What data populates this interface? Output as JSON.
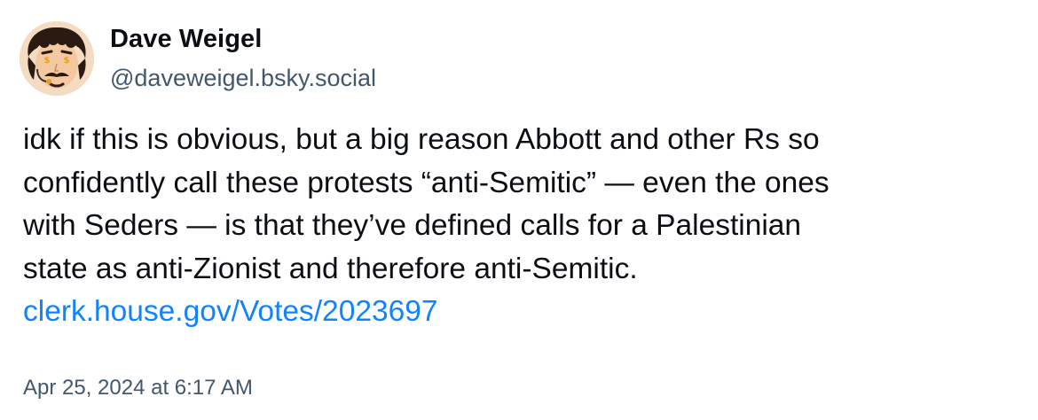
{
  "author": {
    "display_name": "Dave Weigel",
    "handle": "@daveweigel.bsky.social",
    "avatar_icon": "cartoon-face-avatar-icon"
  },
  "post": {
    "text_lines": [
      "idk if this is obvious, but a big reason Abbott and other Rs so",
      "confidently call these protests “anti-Semitic” — even the ones",
      "with Seders — is that they’ve defined calls for a Palestinian",
      "state as anti-Zionist and therefore anti-Semitic."
    ],
    "link_text": "clerk.house.gov/Votes/2023697",
    "timestamp": "Apr 25, 2024 at 6:17 AM"
  },
  "colors": {
    "text": "#0b0f14",
    "secondary_text": "#42576c",
    "link": "#1083fe",
    "background": "#ffffff"
  }
}
